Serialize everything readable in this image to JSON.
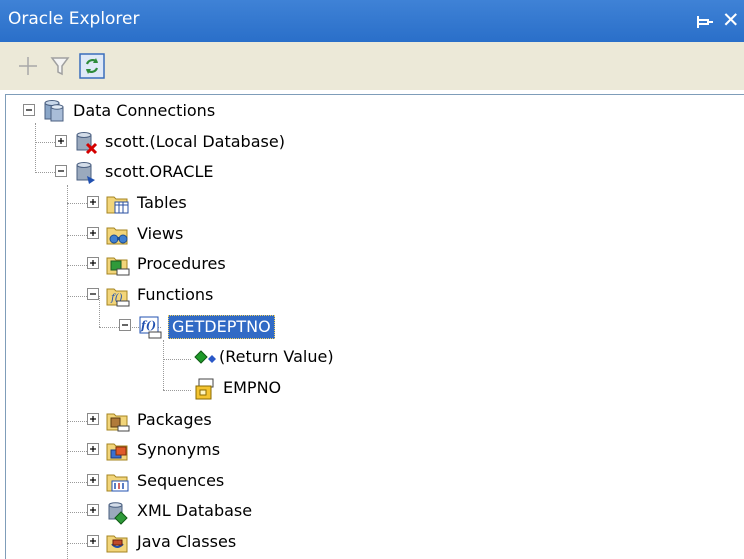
{
  "window": {
    "title": "Oracle Explorer",
    "close_glyph": "✕"
  },
  "toolbar": {
    "buttons": [
      {
        "name": "add-connection",
        "icon": "plus-icon"
      },
      {
        "name": "filter",
        "icon": "funnel-icon"
      },
      {
        "name": "refresh",
        "icon": "refresh-icon"
      }
    ]
  },
  "tree": {
    "root": "Data Connections",
    "local_db": "scott.(Local Database)",
    "oracle_db": "scott.ORACLE",
    "tables": "Tables",
    "views": "Views",
    "procedures": "Procedures",
    "functions": "Functions",
    "function_name": "GETDEPTNO",
    "return_value": "(Return Value)",
    "param": "EMPNO",
    "packages": "Packages",
    "synonyms": "Synonyms",
    "sequences": "Sequences",
    "xml_database": "XML Database",
    "java_classes": "Java Classes"
  },
  "colors": {
    "title_bar": "#2a6fc9",
    "selection": "#316ac5",
    "toolbar_bg": "#ece9d8"
  }
}
